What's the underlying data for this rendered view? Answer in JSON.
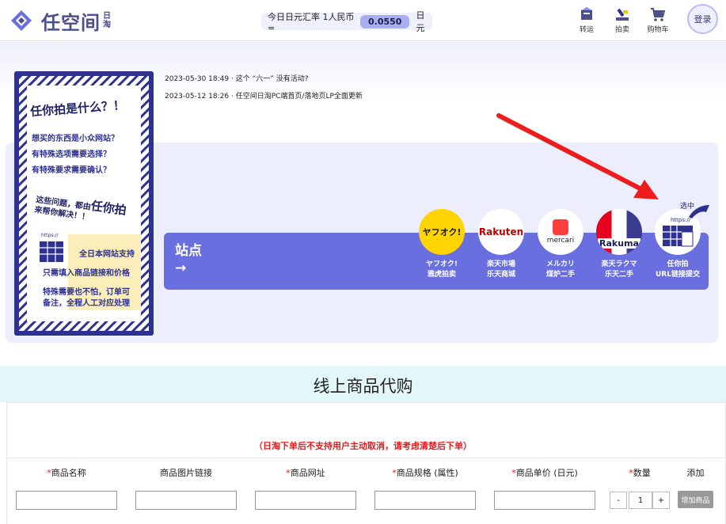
{
  "header": {
    "logo_text": "任空间",
    "logo_sub": "日淘",
    "rate_label": "今日日元汇率 1人民币=",
    "rate_value": "0.0550",
    "rate_unit": "日元",
    "nav": [
      {
        "label": "转运",
        "icon": "transfer-icon"
      },
      {
        "label": "拍卖",
        "icon": "auction-icon"
      },
      {
        "label": "购物车",
        "icon": "cart-icon"
      }
    ],
    "login_label": "登录"
  },
  "news": [
    {
      "date": "2023-05-30 18:49 ·",
      "title": "这个 “六一” 没有活动?"
    },
    {
      "date": "2023-05-12 18:26 ·",
      "title": "任空间日淘PC端首页/落地页LP全面更新"
    }
  ],
  "poster": {
    "title": "任你拍是什么？！",
    "lines": [
      "想买的东西是小众网站？",
      "有特殊选项需要选择？",
      "有特殊要求需要确认？"
    ],
    "mid_line1": "这些问题，都由",
    "mid_brand": "任你拍",
    "mid_line2": "来帮你解决！！",
    "url_hint": "https://",
    "features": [
      "全日本网站支持",
      "只需填入商品链接和价格",
      "特殊需要也不怕，订单可",
      "备注，全程人工对应处理"
    ]
  },
  "sites": {
    "title": "站点",
    "arrow": "→",
    "selected_tag": "选中",
    "items": [
      {
        "logo": "ヤフオク!",
        "name_jp": "ヤフオク!",
        "name_cn": "雅虎拍卖",
        "color": "#ffd400"
      },
      {
        "logo": "Rakuten",
        "name_jp": "楽天市場",
        "name_cn": "乐天商城",
        "color": "#ffffff"
      },
      {
        "logo": "mercari",
        "name_jp": "メルカリ",
        "name_cn": "煤炉二手",
        "color": "#ffffff"
      },
      {
        "logo": "Rakuma",
        "name_jp": "楽天ラクマ",
        "name_cn": "乐天二手",
        "color": "#ffffff"
      },
      {
        "logo": "https://",
        "name_jp": "任你拍",
        "name_cn": "URL链接提交",
        "color": "#ffffff"
      }
    ]
  },
  "proxy": {
    "title": "线上商品代购",
    "warning": "（日淘下单后不支持用户主动取消，请考虑清楚后下单）",
    "columns": [
      {
        "label": "商品名称",
        "required": true
      },
      {
        "label": "商品图片链接",
        "required": false
      },
      {
        "label": "商品网址",
        "required": true
      },
      {
        "label": "商品规格 (属性)",
        "required": true
      },
      {
        "label": "商品单价 (日元)",
        "required": true
      },
      {
        "label": "数量",
        "required": true
      },
      {
        "label": "添加",
        "required": false
      }
    ],
    "required_mark": "*",
    "qty_minus": "-",
    "qty_value": "1",
    "qty_plus": "+",
    "add_button": "增加商品"
  },
  "colors": {
    "brand": "#4b4f8c",
    "site_bar": "#6a6fe0",
    "warning": "#e31b1b",
    "arrow": "#ee1c1c"
  }
}
